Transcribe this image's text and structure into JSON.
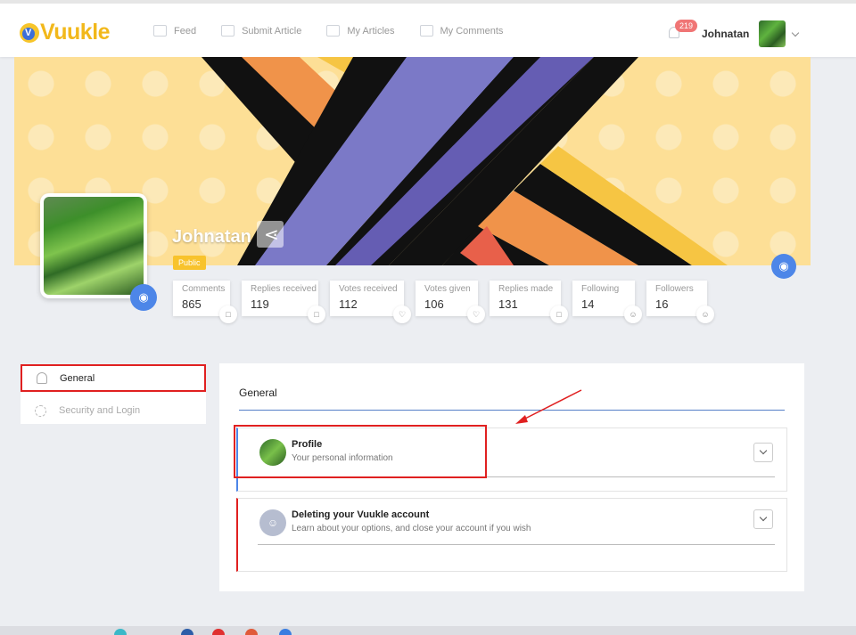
{
  "brand": {
    "logo_letter": "V",
    "name": "Vuukle"
  },
  "nav": [
    {
      "label": "Feed",
      "icon": "feed-icon"
    },
    {
      "label": "Submit Article",
      "icon": "submit-article-icon"
    },
    {
      "label": "My Articles",
      "icon": "articles-icon"
    },
    {
      "label": "My Comments",
      "icon": "comments-icon"
    }
  ],
  "header": {
    "notifications": "219",
    "user_name": "Johnatan"
  },
  "profile": {
    "name": "Johnatan",
    "visibility": "Public"
  },
  "stats": [
    {
      "label": "Comments",
      "value": "865",
      "icon": "comment-icon"
    },
    {
      "label": "Replies received",
      "value": "119",
      "icon": "reply-icon"
    },
    {
      "label": "Votes received",
      "value": "112",
      "icon": "heart-plus-icon"
    },
    {
      "label": "Votes given",
      "value": "106",
      "icon": "heart-arrow-icon"
    },
    {
      "label": "Replies made",
      "value": "131",
      "icon": "reply-icon"
    },
    {
      "label": "Following",
      "value": "14",
      "icon": "users-icon"
    },
    {
      "label": "Followers",
      "value": "16",
      "icon": "users-icon"
    }
  ],
  "sidebar": {
    "items": [
      {
        "label": "General",
        "icon": "person-icon"
      },
      {
        "label": "Security and Login",
        "icon": "gear-icon"
      }
    ]
  },
  "main": {
    "title": "General",
    "cards": [
      {
        "title": "Profile",
        "subtitle": "Your personal information"
      },
      {
        "title": "Deleting your Vuukle account",
        "subtitle": "Learn about your options, and close your account if you wish"
      }
    ]
  },
  "colors": {
    "accent": "#4d86e8",
    "brand": "#f2b81b",
    "highlight": "#e02020",
    "cover": "#fddf96"
  }
}
